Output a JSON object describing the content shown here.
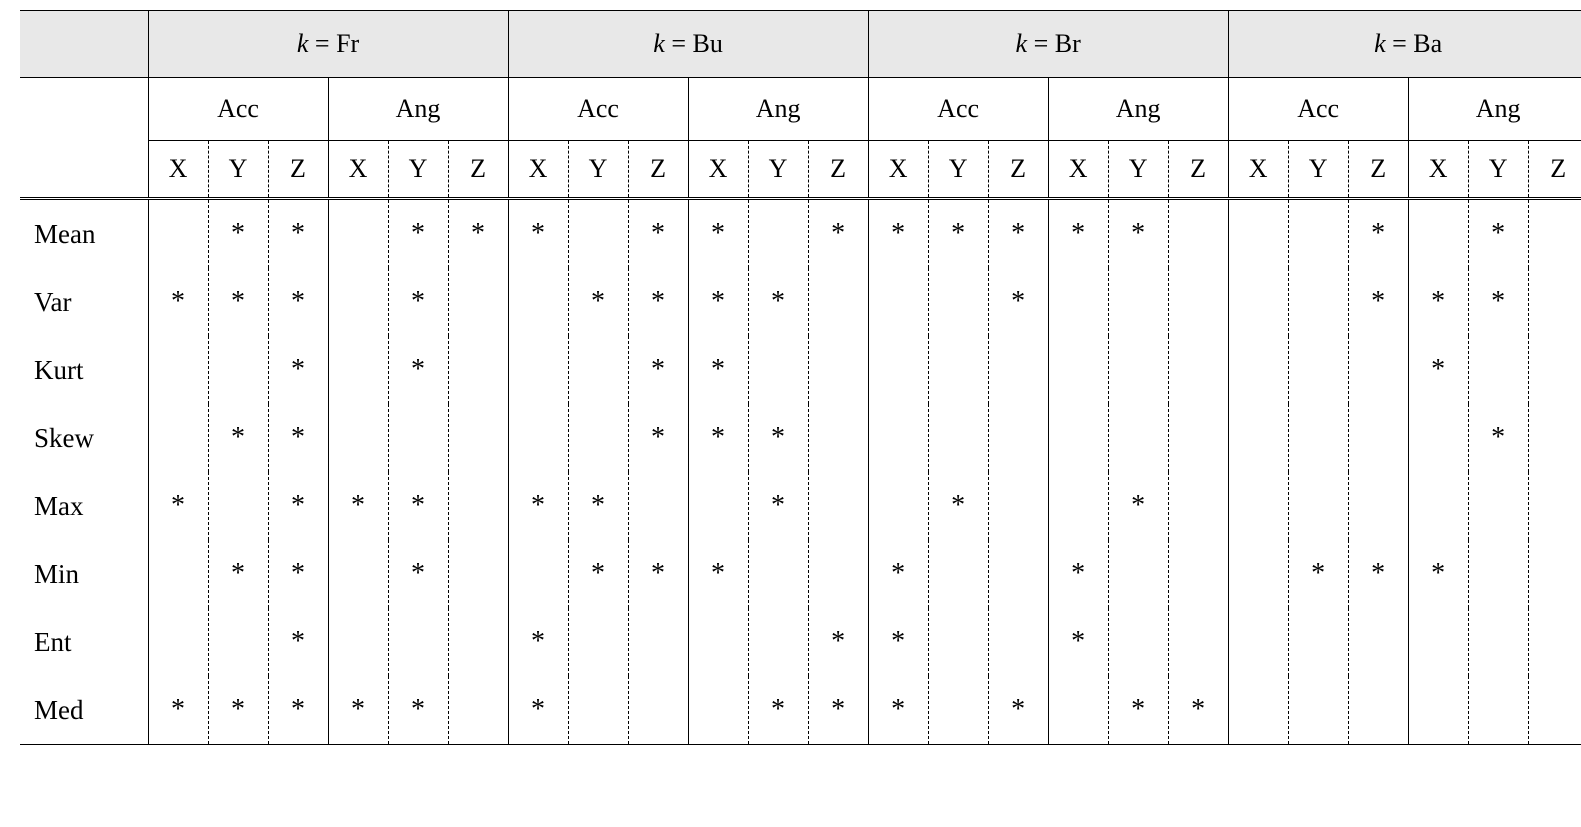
{
  "table": {
    "k_label_prefix": "k = ",
    "k_groups": [
      "Fr",
      "Bu",
      "Br",
      "Ba"
    ],
    "sub_groups": [
      "Acc",
      "Ang"
    ],
    "axes": [
      "X",
      "Y",
      "Z"
    ],
    "row_labels": [
      "Mean",
      "Var",
      "Kurt",
      "Skew",
      "Max",
      "Min",
      "Ent",
      "Med"
    ],
    "mark_symbol": "*",
    "marks": [
      [
        0,
        1,
        1,
        0,
        1,
        1,
        1,
        0,
        1,
        1,
        0,
        1,
        1,
        1,
        1,
        1,
        1,
        0,
        0,
        0,
        1,
        0,
        1,
        0
      ],
      [
        1,
        1,
        1,
        0,
        1,
        0,
        0,
        1,
        1,
        1,
        1,
        0,
        0,
        0,
        1,
        0,
        0,
        0,
        0,
        0,
        1,
        1,
        1,
        0
      ],
      [
        0,
        0,
        1,
        0,
        1,
        0,
        0,
        0,
        1,
        1,
        0,
        0,
        0,
        0,
        0,
        0,
        0,
        0,
        0,
        0,
        0,
        1,
        0,
        0
      ],
      [
        0,
        1,
        1,
        0,
        0,
        0,
        0,
        0,
        1,
        1,
        1,
        0,
        0,
        0,
        0,
        0,
        0,
        0,
        0,
        0,
        0,
        0,
        1,
        0
      ],
      [
        1,
        0,
        1,
        1,
        1,
        0,
        1,
        1,
        0,
        0,
        1,
        0,
        0,
        1,
        0,
        0,
        1,
        0,
        0,
        0,
        0,
        0,
        0,
        0
      ],
      [
        0,
        1,
        1,
        0,
        1,
        0,
        0,
        1,
        1,
        1,
        0,
        0,
        1,
        0,
        0,
        1,
        0,
        0,
        0,
        1,
        1,
        1,
        0,
        0
      ],
      [
        0,
        0,
        1,
        0,
        0,
        0,
        1,
        0,
        0,
        0,
        0,
        1,
        1,
        0,
        0,
        1,
        0,
        0,
        0,
        0,
        0,
        0,
        0,
        0
      ],
      [
        1,
        1,
        1,
        1,
        1,
        0,
        1,
        0,
        0,
        0,
        1,
        1,
        1,
        0,
        1,
        0,
        1,
        1,
        0,
        0,
        0,
        0,
        0,
        0
      ]
    ]
  }
}
